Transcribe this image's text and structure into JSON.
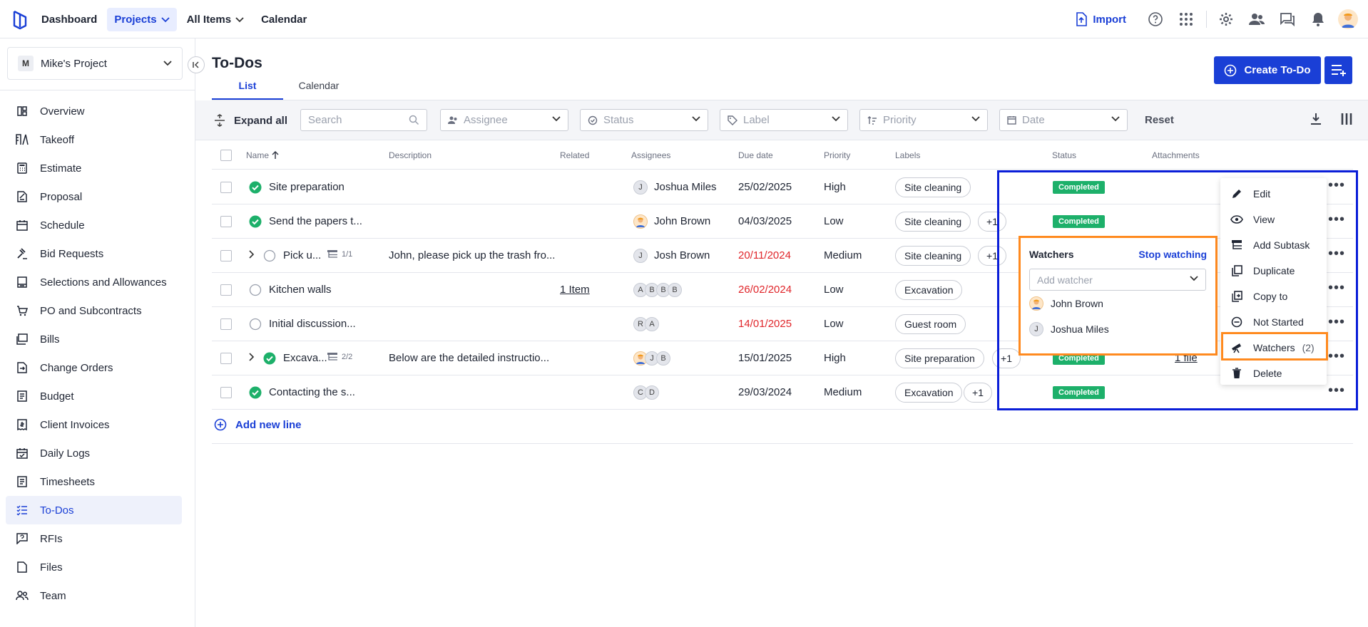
{
  "topnav": {
    "items": [
      {
        "label": "Dashboard",
        "active": false,
        "dropdown": false
      },
      {
        "label": "Projects",
        "active": true,
        "dropdown": true
      },
      {
        "label": "All Items",
        "active": false,
        "dropdown": true
      },
      {
        "label": "Calendar",
        "active": false,
        "dropdown": false
      }
    ],
    "import_label": "Import",
    "icons": [
      "help-icon",
      "apps-grid-icon",
      "settings-gear-icon",
      "people-icon",
      "chat-icon",
      "bell-icon"
    ]
  },
  "project": {
    "badge": "M",
    "name": "Mike's Project"
  },
  "sidebar": {
    "items": [
      {
        "label": "Overview",
        "icon": "overview-icon"
      },
      {
        "label": "Takeoff",
        "icon": "takeoff-icon"
      },
      {
        "label": "Estimate",
        "icon": "calculator-icon"
      },
      {
        "label": "Proposal",
        "icon": "proposal-icon"
      },
      {
        "label": "Schedule",
        "icon": "calendar-icon"
      },
      {
        "label": "Bid Requests",
        "icon": "gavel-icon"
      },
      {
        "label": "Selections and Allowances",
        "icon": "selections-icon"
      },
      {
        "label": "PO and Subcontracts",
        "icon": "cart-icon"
      },
      {
        "label": "Bills",
        "icon": "bills-icon"
      },
      {
        "label": "Change Orders",
        "icon": "change-orders-icon"
      },
      {
        "label": "Budget",
        "icon": "budget-icon"
      },
      {
        "label": "Client Invoices",
        "icon": "invoice-icon"
      },
      {
        "label": "Daily Logs",
        "icon": "daily-log-icon"
      },
      {
        "label": "Timesheets",
        "icon": "timesheet-icon"
      },
      {
        "label": "To-Dos",
        "icon": "todo-list-icon",
        "active": true
      },
      {
        "label": "RFIs",
        "icon": "rfi-icon"
      },
      {
        "label": "Files",
        "icon": "file-icon"
      },
      {
        "label": "Team",
        "icon": "team-icon"
      }
    ]
  },
  "page": {
    "title": "To-Dos",
    "tabs": [
      {
        "label": "List",
        "active": true
      },
      {
        "label": "Calendar",
        "active": false
      }
    ],
    "create_label": "Create To-Do"
  },
  "filters": {
    "expand_all": "Expand all",
    "search_placeholder": "Search",
    "assignee": "Assignee",
    "status": "Status",
    "label": "Label",
    "priority": "Priority",
    "date": "Date",
    "reset": "Reset"
  },
  "table": {
    "headers": {
      "name": "Name",
      "description": "Description",
      "related": "Related",
      "assignees": "Assignees",
      "due_date": "Due date",
      "priority": "Priority",
      "labels": "Labels",
      "status": "Status",
      "attachments": "Attachments"
    },
    "rows": [
      {
        "name": "Site preparation",
        "done": true,
        "expandable": false,
        "subtasks": "",
        "description": "",
        "related": "",
        "assignees": [
          {
            "initial": "J",
            "photo": false
          }
        ],
        "assignee_name": "Joshua Miles",
        "due": "25/02/2025",
        "overdue": false,
        "priority": "High",
        "label": "Site cleaning",
        "extra_labels": "",
        "status": "Completed",
        "attachment": ""
      },
      {
        "name": "Send the papers t...",
        "done": true,
        "expandable": false,
        "subtasks": "",
        "description": "",
        "related": "",
        "assignees": [
          {
            "initial": "",
            "photo": true
          }
        ],
        "assignee_name": "John Brown",
        "due": "04/03/2025",
        "overdue": false,
        "priority": "Low",
        "label": "Site cleaning",
        "extra_labels": "+1",
        "status": "Completed",
        "attachment": ""
      },
      {
        "name": "Pick u...",
        "done": false,
        "expandable": true,
        "subtasks": "1/1",
        "description": "John, please pick up the trash fro...",
        "related": "",
        "assignees": [
          {
            "initial": "J",
            "photo": false
          }
        ],
        "assignee_name": "Josh Brown",
        "due": "20/11/2024",
        "overdue": true,
        "priority": "Medium",
        "label": "Site cleaning",
        "extra_labels": "+1",
        "status": "",
        "attachment": ""
      },
      {
        "name": "Kitchen walls",
        "done": false,
        "expandable": false,
        "subtasks": "",
        "description": "",
        "related": "1 Item",
        "assignees": [
          {
            "initial": "A",
            "photo": false
          },
          {
            "initial": "B",
            "photo": false
          },
          {
            "initial": "B",
            "photo": false
          },
          {
            "initial": "B",
            "photo": false
          }
        ],
        "assignee_name": "",
        "due": "26/02/2024",
        "overdue": true,
        "priority": "Low",
        "label": "Excavation",
        "extra_labels": "",
        "status": "",
        "attachment": ""
      },
      {
        "name": "Initial discussion...",
        "done": false,
        "expandable": false,
        "subtasks": "",
        "description": "",
        "related": "",
        "assignees": [
          {
            "initial": "R",
            "photo": false
          },
          {
            "initial": "A",
            "photo": false
          }
        ],
        "assignee_name": "",
        "due": "14/01/2025",
        "overdue": true,
        "priority": "Low",
        "label": "Guest room",
        "extra_labels": "",
        "status": "",
        "attachment": ""
      },
      {
        "name": "Excava...",
        "done": true,
        "expandable": true,
        "subtasks": "2/2",
        "description": "Below are the detailed instructio...",
        "related": "",
        "assignees": [
          {
            "initial": "",
            "photo": true
          },
          {
            "initial": "J",
            "photo": false
          },
          {
            "initial": "B",
            "photo": false
          }
        ],
        "assignee_name": "",
        "due": "15/01/2025",
        "overdue": false,
        "priority": "High",
        "label": "Site preparation",
        "extra_labels": "+1",
        "status": "Completed",
        "attachment": "1 file"
      },
      {
        "name": "Contacting the s...",
        "done": true,
        "expandable": false,
        "subtasks": "",
        "description": "",
        "related": "",
        "assignees": [
          {
            "initial": "C",
            "photo": false
          },
          {
            "initial": "D",
            "photo": false
          }
        ],
        "assignee_name": "",
        "due": "29/03/2024",
        "overdue": false,
        "priority": "Medium",
        "label": "Excavation",
        "extra_labels": "+1",
        "status": "Completed",
        "attachment": ""
      }
    ],
    "add_line": "Add new line"
  },
  "watchers_popover": {
    "title": "Watchers",
    "stop_label": "Stop watching",
    "placeholder": "Add watcher",
    "users": [
      {
        "name": "John Brown",
        "photo": true,
        "initial": ""
      },
      {
        "name": "Joshua Miles",
        "photo": false,
        "initial": "J"
      }
    ]
  },
  "context_menu": {
    "items": [
      {
        "label": "Edit",
        "icon": "pencil-icon"
      },
      {
        "label": "View",
        "icon": "eye-icon"
      },
      {
        "label": "Add Subtask",
        "icon": "subtask-icon"
      },
      {
        "label": "Duplicate",
        "icon": "duplicate-icon"
      },
      {
        "label": "Copy to",
        "icon": "copy-to-icon"
      },
      {
        "label": "Not Started",
        "icon": "not-started-icon"
      },
      {
        "label": "Watchers",
        "icon": "telescope-icon",
        "count": "(2)"
      },
      {
        "label": "Delete",
        "icon": "trash-icon"
      }
    ]
  },
  "colors": {
    "accent": "#1a3fd6",
    "completed": "#1db06a",
    "overdue": "#e0262b",
    "highlight_blue": "#0a1ed8",
    "highlight_orange": "#ff8a1f"
  }
}
